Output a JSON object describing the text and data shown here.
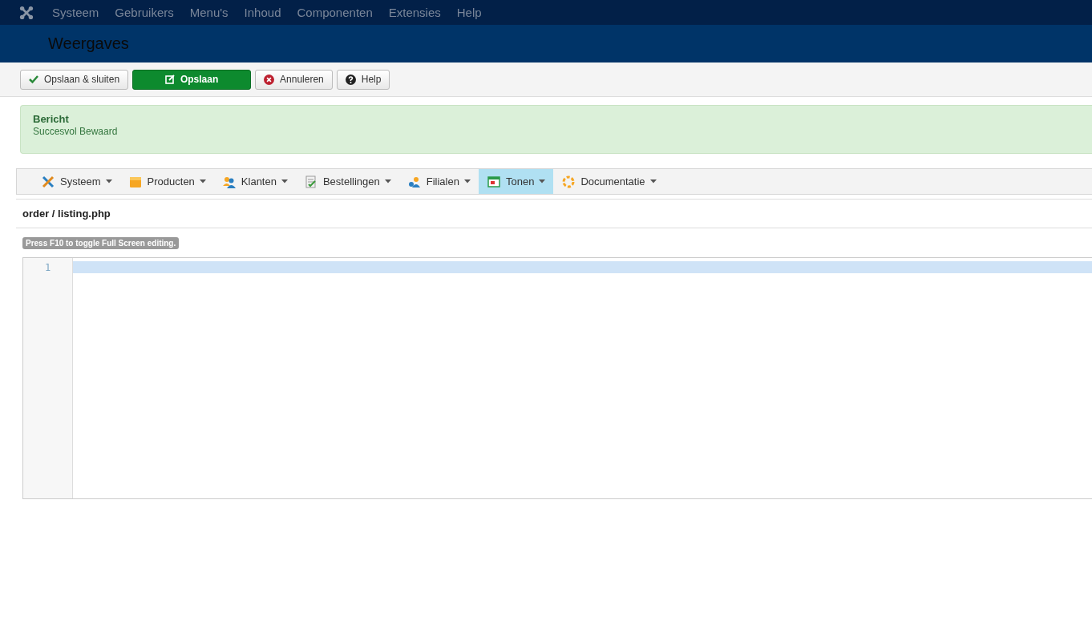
{
  "top_menu": [
    "Systeem",
    "Gebruikers",
    "Menu's",
    "Inhoud",
    "Componenten",
    "Extensies",
    "Help"
  ],
  "page_title": "Weergaves",
  "toolbar": [
    {
      "label": "Opslaan & sluiten",
      "kind": "check"
    },
    {
      "label": "Opslaan",
      "kind": "primary"
    },
    {
      "label": "Annuleren",
      "kind": "cancel"
    },
    {
      "label": "Help",
      "kind": "help"
    }
  ],
  "message": {
    "heading": "Bericht",
    "text": "Succesvol Bewaard"
  },
  "component_menu": [
    {
      "label": "Systeem",
      "kind": "tools",
      "selected": false
    },
    {
      "label": "Producten",
      "kind": "folder",
      "selected": false
    },
    {
      "label": "Klanten",
      "kind": "users",
      "selected": false
    },
    {
      "label": "Bestellingen",
      "kind": "document",
      "selected": false
    },
    {
      "label": "Filialen",
      "kind": "store",
      "selected": false
    },
    {
      "label": "Tonen",
      "kind": "window",
      "selected": true
    },
    {
      "label": "Documentatie",
      "kind": "lifebuoy",
      "selected": false
    }
  ],
  "file_path": "order / listing.php",
  "editor_hint": "Press F10 to toggle Full Screen editing.",
  "editor": {
    "line_numbers": [
      "1"
    ]
  }
}
